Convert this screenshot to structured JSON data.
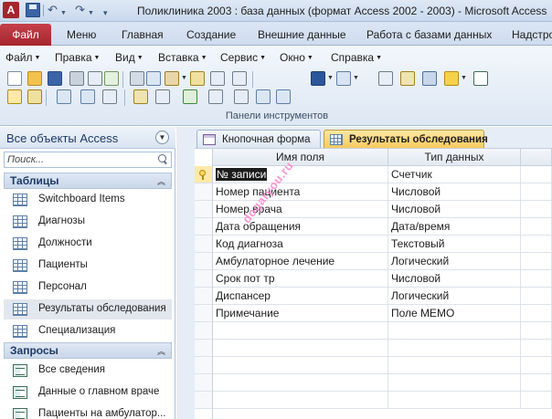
{
  "window": {
    "title": "Поликлиника 2003 : база данных (формат Access 2002 - 2003)  -  Microsoft Access",
    "app_icon_letter": "A"
  },
  "ribbon": {
    "file_tab": "Файл",
    "tabs": [
      "Меню",
      "Главная",
      "Создание",
      "Внешние данные",
      "Работа с базами данных",
      "Надстро"
    ]
  },
  "menubar": {
    "items": [
      "Файл",
      "Правка",
      "Вид",
      "Вставка",
      "Сервис",
      "Окно",
      "Справка"
    ]
  },
  "toolbar": {
    "group_label": "Панели инструментов",
    "row1_icons": [
      "new-icon",
      "open-icon",
      "save-icon",
      "print-icon",
      "preview-icon",
      "spellcheck-icon",
      "cut-icon",
      "copy-icon",
      "paste-icon",
      "format-painter-icon",
      "undo-icon",
      "redo-icon",
      "office-links-icon",
      "analyze-icon",
      "code-icon",
      "properties-icon",
      "build-icon",
      "database-window-icon",
      "new-object-icon",
      "help-icon"
    ],
    "row2_icons": [
      "primary-key-icon",
      "build-icon",
      "insert-rows-icon",
      "delete-rows-icon",
      "properties-icon",
      "indexes-icon",
      "macro-icon",
      "check-icon",
      "sort-icon",
      "filter-icon",
      "toggle-filter-icon",
      "query-icon"
    ],
    "accent_color": "#a4262c"
  },
  "nav": {
    "title": "Все объекты Access",
    "search_placeholder": "Поиск...",
    "sections": [
      {
        "label": "Таблицы",
        "items": [
          "Switchboard Items",
          "Диагнозы",
          "Должности",
          "Пациенты",
          "Персонал",
          "Результаты обследования",
          "Специализация"
        ],
        "selected_index": 5
      },
      {
        "label": "Запросы",
        "items": [
          "Все сведения",
          "Данные о главном враче",
          "Пациенты на амбулатор..."
        ]
      }
    ]
  },
  "document_tabs": [
    {
      "label": "Кнопочная форма",
      "active": false
    },
    {
      "label": "Результаты обследования",
      "active": true
    }
  ],
  "design_grid": {
    "headers": [
      "Имя поля",
      "Тип данных"
    ],
    "rows": [
      {
        "field": "№ записи",
        "type": "Счетчик",
        "primary_key": true
      },
      {
        "field": "Номер пациента",
        "type": "Числовой"
      },
      {
        "field": "Номер врача",
        "type": "Числовой"
      },
      {
        "field": "Дата обращения",
        "type": "Дата/время"
      },
      {
        "field": "Код диагноза",
        "type": "Текстовый"
      },
      {
        "field": "Амбулаторное лечение",
        "type": "Логический"
      },
      {
        "field": "Срок пот тр",
        "type": "Числовой"
      },
      {
        "field": "Диспансер",
        "type": "Логический"
      },
      {
        "field": "Примечание",
        "type": "Поле МЕМО"
      }
    ]
  },
  "watermark": "dogaryou.ru"
}
